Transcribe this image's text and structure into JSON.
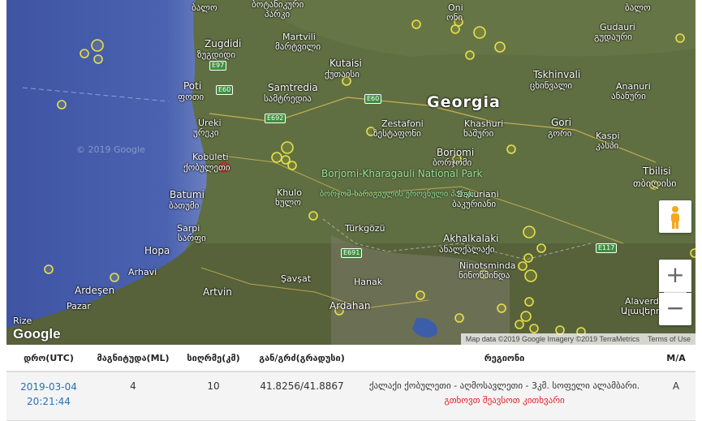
{
  "map": {
    "country_label": "Georgia",
    "places": [
      {
        "id": "zugdidi",
        "name": "Zugdidi",
        "local": "ზუგდიდი"
      },
      {
        "id": "poti",
        "name": "Poti",
        "local": "ფოთი"
      },
      {
        "id": "samtredia",
        "name": "Samtredia",
        "local": "სამტრედია"
      },
      {
        "id": "kutaisi",
        "name": "Kutaisi",
        "local": "ქუთაისი"
      },
      {
        "id": "martvili",
        "name": "Martvili",
        "local": "მარტვილი"
      },
      {
        "id": "ureki",
        "name": "Ureki",
        "local": "ურეკი"
      },
      {
        "id": "kobuleti",
        "name": "Kobuleti",
        "local": "ქობულეთი"
      },
      {
        "id": "batumi",
        "name": "Batumi",
        "local": "ბათუმი"
      },
      {
        "id": "sarpi",
        "name": "Sarpi",
        "local": "სარფი"
      },
      {
        "id": "hopa",
        "name": "Hopa",
        "local": ""
      },
      {
        "id": "arhavi",
        "name": "Arhavi",
        "local": ""
      },
      {
        "id": "ardesen",
        "name": "Ardeşen",
        "local": ""
      },
      {
        "id": "pazar",
        "name": "Pazar",
        "local": ""
      },
      {
        "id": "rize",
        "name": "Rize",
        "local": ""
      },
      {
        "id": "artvin",
        "name": "Artvin",
        "local": ""
      },
      {
        "id": "savsat",
        "name": "Şavşat",
        "local": ""
      },
      {
        "id": "hanak",
        "name": "Hanak",
        "local": ""
      },
      {
        "id": "ardahan",
        "name": "Ardahan",
        "local": ""
      },
      {
        "id": "turkgozu",
        "name": "Türkgözü",
        "local": ""
      },
      {
        "id": "khulo",
        "name": "Khulo",
        "local": "ხულო"
      },
      {
        "id": "zestafoni",
        "name": "Zestafoni",
        "local": "ზესტაფონი"
      },
      {
        "id": "khashuri",
        "name": "Khashuri",
        "local": "ხაშური"
      },
      {
        "id": "borjomi",
        "name": "Borjomi",
        "local": "ბორჯომი"
      },
      {
        "id": "bakuriani",
        "name": "Bakuriani",
        "local": "ბაკურიანი"
      },
      {
        "id": "akhalkalaki",
        "name": "Akhalkalaki",
        "local": "ახალქალაქი"
      },
      {
        "id": "ninotsminda",
        "name": "Ninotsminda",
        "local": "ნინოწმინდა"
      },
      {
        "id": "gori",
        "name": "Gori",
        "local": "გორი"
      },
      {
        "id": "kaspi",
        "name": "Kaspi",
        "local": "კასპი"
      },
      {
        "id": "tbilisi",
        "name": "Tbilisi",
        "local": "თბილისი"
      },
      {
        "id": "tskhinvali",
        "name": "Tskhinvali",
        "local": "ცხინვალი"
      },
      {
        "id": "gudauri",
        "name": "Gudauri",
        "local": "გუდაური"
      },
      {
        "id": "ananuri",
        "name": "Ananuri",
        "local": "ანანური"
      },
      {
        "id": "oni",
        "name": "Oni",
        "local": "ონი"
      },
      {
        "id": "alaverdi",
        "name": "Alaverdi",
        "local": "Ալավերդի"
      }
    ],
    "partial_labels": {
      "top1": "ბალო",
      "top2": "ბოტანიკური",
      "top3": "პარკი",
      "top_right": "ბალო"
    },
    "park": {
      "name": "Borjomi-Kharagauli National Park",
      "local": "ბორჯომ-ხარაგაულის ეროვნული პარკი"
    },
    "roads": [
      "E97",
      "E60",
      "E692",
      "E60",
      "E691",
      "E117"
    ],
    "watermark": "© 2019 Google",
    "logo": "Google",
    "attribution": {
      "data": "Map data ©2019 Google Imagery ©2019 TerraMetrics",
      "terms": "Terms of Use"
    },
    "zoom_in": "+",
    "zoom_out": "−"
  },
  "table": {
    "headers": [
      "დრო(UTC)",
      "მაგნიტუდა(ML)",
      "სიღრმე(კმ)",
      "გან/გრძ(გრადუსი)",
      "რეგიონი",
      "M/A"
    ],
    "rows": [
      {
        "date": "2019-03-04",
        "time": "20:21:44",
        "magnitude": "4",
        "depth": "10",
        "coords": "41.8256/41.8867",
        "region": "ქალაქი ქობულეთი - აღმოსავლეთი - 3კმ. სოფელი ალამბარი.",
        "more_link": "გთხოვთ შეავსოთ კითხვარი",
        "ma": "A"
      }
    ]
  }
}
